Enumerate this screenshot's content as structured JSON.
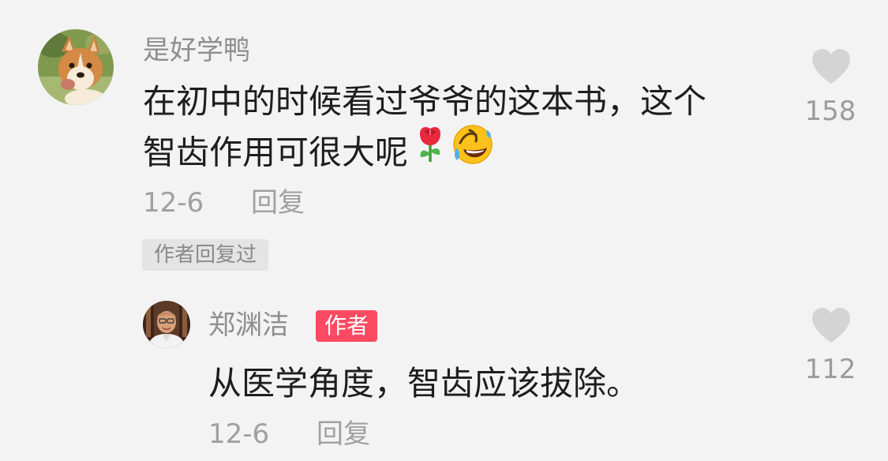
{
  "comments": [
    {
      "username": "是好学鸭",
      "text_lines": [
        "在初中的时候看过爷爷的这本书，这个",
        "智齿作用可很大呢"
      ],
      "emojis": [
        "rose-emoji",
        "rolling-on-floor-laughing-emoji"
      ],
      "date": "12-6",
      "reply_label": "回复",
      "likes": "158",
      "badge": "作者回复过"
    },
    {
      "username": "郑渊洁",
      "author_tag": "作者",
      "text": "从医学角度，智齿应该拔除。",
      "date": "12-6",
      "reply_label": "回复",
      "likes": "112"
    }
  ],
  "colors": {
    "background": "#f3f3f3",
    "text": "#1e1e1e",
    "secondary": "#9b9b9b",
    "author_badge": "#fc4a62",
    "replied_badge_bg": "#e4e4e4",
    "like_icon": "#d4d4d4"
  }
}
